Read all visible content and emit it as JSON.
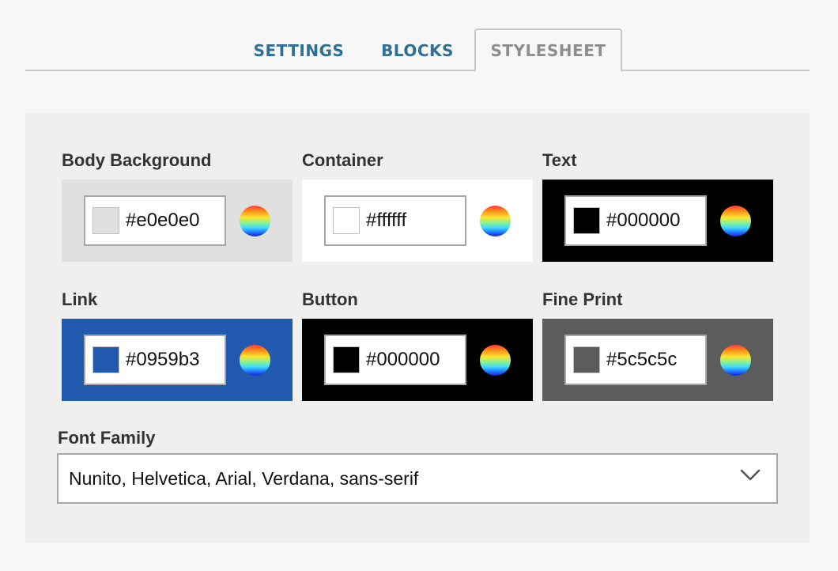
{
  "tabs": [
    {
      "label": "SETTINGS",
      "active": false
    },
    {
      "label": "BLOCKS",
      "active": false
    },
    {
      "label": "STYLESHEET",
      "active": true
    }
  ],
  "colors": [
    {
      "label": "Body Background",
      "value": "#e0e0e0",
      "swatch": "#e0e0e0",
      "background": "#e0e0e0"
    },
    {
      "label": "Container",
      "value": "#ffffff",
      "swatch": "#ffffff",
      "background": "#ffffff"
    },
    {
      "label": "Text",
      "value": "#000000",
      "swatch": "#000000",
      "background": "#000000"
    },
    {
      "label": "Link",
      "value": "#0959b3",
      "swatch": "#2159ae",
      "background": "#2159ae"
    },
    {
      "label": "Button",
      "value": "#000000",
      "swatch": "#000000",
      "background": "#000000"
    },
    {
      "label": "Fine Print",
      "value": "#5c5c5c",
      "swatch": "#5c5c5c",
      "background": "#5c5c5c"
    }
  ],
  "font_family": {
    "label": "Font Family",
    "value": "Nunito, Helvetica, Arial, Verdana, sans-serif"
  },
  "icons": {
    "picker": "color-wheel-icon",
    "dropdown": "chevron-down-icon"
  }
}
